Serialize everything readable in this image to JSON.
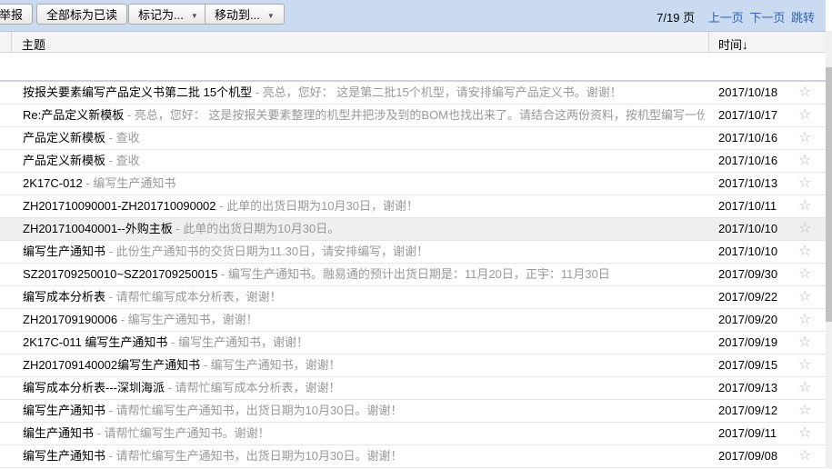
{
  "toolbar": {
    "buttons": [
      "举报",
      "全部标为已读",
      "标记为...",
      "移动到..."
    ],
    "pager": {
      "current": "7/19 页",
      "prev": "上一页",
      "next": "下一页",
      "jump": "跳转"
    }
  },
  "columns": {
    "subject": "主题",
    "time": "时间↓"
  },
  "emails": [
    {
      "subject": "按报关要素编写产品定义书第二批 15个机型",
      "preview": " - 亮总，您好： 这是第二批15个机型，请安排编写产品定义书。谢谢！",
      "date": "2017/10/18"
    },
    {
      "subject": "Re:产品定义新模板",
      "preview": " - 亮总，您好： 这是按报关要素整理的机型并把涉及到的BOM也找出来了。请结合这两份资料，按机型编写一份大",
      "date": "2017/10/17"
    },
    {
      "subject": "产品定义新模板",
      "preview": " - 查收",
      "date": "2017/10/16"
    },
    {
      "subject": "产品定义新模板",
      "preview": " - 查收",
      "date": "2017/10/16"
    },
    {
      "subject": "2K17C-012",
      "preview": " - 编写生产通知书",
      "date": "2017/10/13"
    },
    {
      "subject": "ZH201710090001-ZH201710090002",
      "preview": " - 此单的出货日期为10月30日，谢谢！",
      "date": "2017/10/11"
    },
    {
      "subject": "ZH201710040001--外购主板",
      "preview": " - 此单的出货日期为10月30日。",
      "date": "2017/10/10"
    },
    {
      "subject": "编写生产通知书",
      "preview": " - 此份生产通知书的交货日期为11.30日，请安排编写，谢谢！",
      "date": "2017/10/10"
    },
    {
      "subject": "SZ201709250010~SZ201709250015",
      "preview": " - 编写生产通知书。融易通的预计出货日期是：11月20日，正宇：11月30日",
      "date": "2017/09/30"
    },
    {
      "subject": "编写成本分析表",
      "preview": " - 请帮忙编写成本分析表，谢谢！",
      "date": "2017/09/22"
    },
    {
      "subject": "ZH201709190006",
      "preview": " - 编写生产通知书，谢谢！",
      "date": "2017/09/20"
    },
    {
      "subject": "2K17C-011 编写生产通知书",
      "preview": " - 编写生产通知书，谢谢！",
      "date": "2017/09/19"
    },
    {
      "subject": "ZH201709140002编写生产通知书",
      "preview": " - 编写生产通知书，谢谢！",
      "date": "2017/09/15"
    },
    {
      "subject": "编写成本分析表---深圳海派",
      "preview": " - 请帮忙编写成本分析表，谢谢！",
      "date": "2017/09/13"
    },
    {
      "subject": "编写生产通知书",
      "preview": " - 请帮忙编写生产通知书，出货日期为10月30日。谢谢！",
      "date": "2017/09/12"
    },
    {
      "subject": "编生产通知书",
      "preview": " - 请帮忙编写生产通知书。谢谢！",
      "date": "2017/09/11"
    },
    {
      "subject": "编写生产通知书",
      "preview": " - 请帮忙编写生产通知书，出货日期为10月30日。谢谢！",
      "date": "2017/09/08"
    }
  ],
  "star_glyph": "☆",
  "highlighted_row": 6,
  "colors": {
    "toolbar": "#c9daf1",
    "link": "#2f63b5",
    "preview": "#999999"
  }
}
